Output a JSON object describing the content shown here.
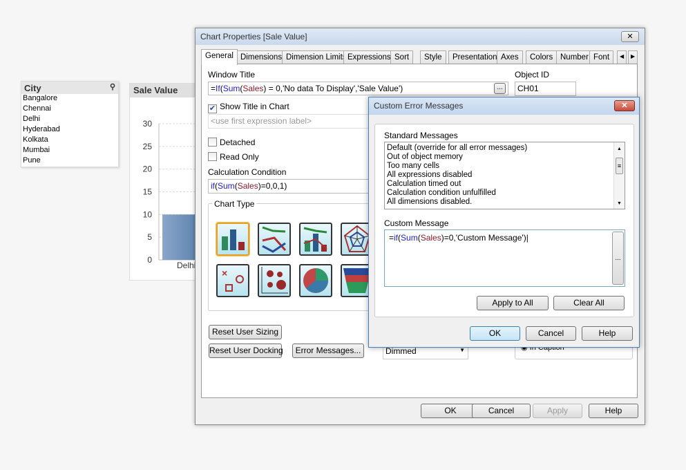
{
  "city_listbox": {
    "title": "City",
    "items": [
      "Bangalore",
      "Chennai",
      "Delhi",
      "Hyderabad",
      "Kolkata",
      "Mumbai",
      "Pune"
    ]
  },
  "sale_chart": {
    "title": "Sale Value",
    "y_ticks": [
      "30",
      "25",
      "20",
      "15",
      "10",
      "5",
      "0"
    ],
    "x_label": "Delhi",
    "bar_value": 10
  },
  "chart_data": {
    "type": "bar",
    "title": "Sale Value",
    "categories": [
      "Delhi"
    ],
    "values": [
      10
    ],
    "ylim": [
      0,
      30
    ]
  },
  "props": {
    "title": "Chart Properties [Sale Value]",
    "tabs": [
      "General",
      "Dimensions",
      "Dimension Limits",
      "Expressions",
      "Sort",
      "Style",
      "Presentation",
      "Axes",
      "Colors",
      "Number",
      "Font"
    ],
    "window_title_label": "Window Title",
    "window_title_parts": [
      "=",
      "If",
      "(",
      "Sum",
      "(",
      "Sales",
      ") = 0,'No data To Display','Sale Value')"
    ],
    "object_id_label": "Object ID",
    "object_id": "CH01",
    "show_title": "Show Title in Chart",
    "title_placeholder": "<use first expression label>",
    "detached": "Detached",
    "read_only": "Read Only",
    "calc_label": "Calculation Condition",
    "calc_parts": [
      "if",
      "(",
      "Sum",
      "(",
      "Sales",
      ")=0,0,1)"
    ],
    "chart_type_label": "Chart Type",
    "reset_sizing": "Reset User Sizing",
    "reset_docking": "Reset User Docking",
    "error_messages": "Error Messages...",
    "dimmed": "Dimmed",
    "in_caption": "In Caption",
    "ok": "OK",
    "cancel": "Cancel",
    "apply": "Apply",
    "help": "Help",
    "ellipsis": "..."
  },
  "dialog": {
    "title": "Custom Error Messages",
    "std_label": "Standard Messages",
    "messages": [
      "Default (override for all error messages)",
      "Out of object memory",
      "Too many cells",
      "All expressions disabled",
      "Calculation timed out",
      "Calculation condition unfulfilled",
      "All dimensions disabled."
    ],
    "custom_label": "Custom Message",
    "custom_parts": [
      "=",
      "if",
      "(",
      "Sum",
      "(",
      "Sales",
      ")=0,'Custom Message')"
    ],
    "apply_all": "Apply to All",
    "clear_all": "Clear All",
    "ok": "OK",
    "cancel": "Cancel",
    "help": "Help",
    "ellipsis": "..."
  }
}
